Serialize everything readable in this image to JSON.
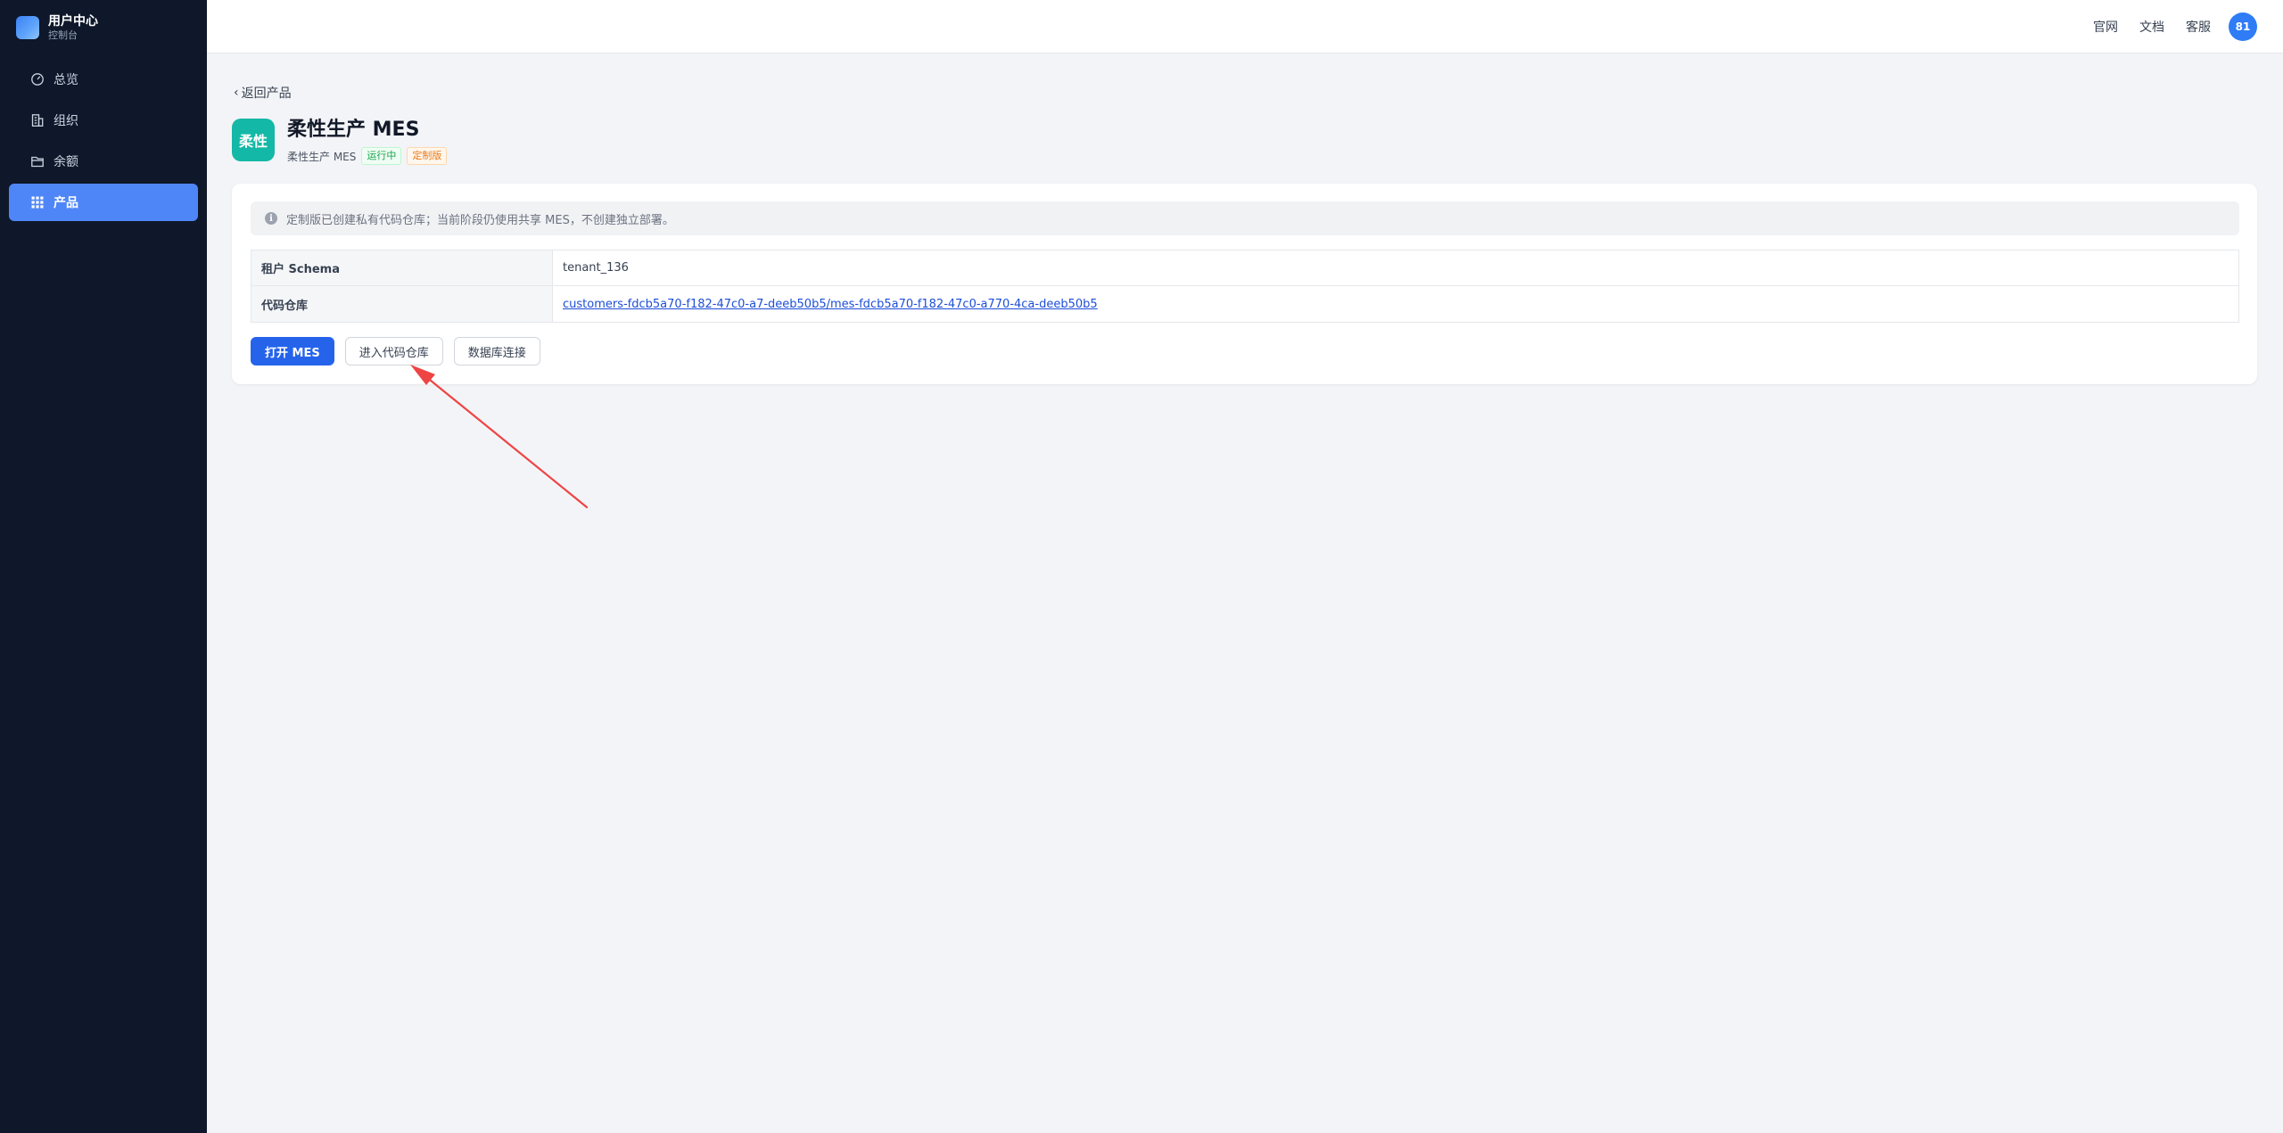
{
  "brand": {
    "title": "用户中心",
    "subtitle": "控制台"
  },
  "sidebar": {
    "items": [
      {
        "label": "总览",
        "icon": "dashboard-icon",
        "active": false
      },
      {
        "label": "组织",
        "icon": "building-icon",
        "active": false
      },
      {
        "label": "余额",
        "icon": "wallet-icon",
        "active": false
      },
      {
        "label": "产品",
        "icon": "grid-icon",
        "active": true
      }
    ]
  },
  "header": {
    "links": [
      "官网",
      "文档",
      "客服"
    ],
    "avatar_text": "81"
  },
  "main": {
    "back_label": "返回产品",
    "product": {
      "logo_text": "柔性",
      "title": "柔性生产 MES",
      "subtitle": "柔性生产 MES",
      "status_tag": "运行中",
      "edition_tag": "定制版"
    },
    "notice": "定制版已创建私有代码仓库；当前阶段仍使用共享 MES，不创建独立部署。",
    "details": [
      {
        "key": "租户 Schema",
        "value": "tenant_136"
      },
      {
        "key": "代码仓库",
        "value": "customers-fdcb5a70-f182-47c0-a7-deeb50b5/mes-fdcb5a70-f182-47c0-a770-4ca-deeb50b5"
      }
    ],
    "actions": {
      "open_mes": "打开 MES",
      "enter_repo": "进入代码仓库",
      "db_connect": "数据库连接"
    }
  },
  "colors": {
    "sidebar_bg": "#0f172a",
    "accent": "#2563eb",
    "active_nav": "#4f86f7",
    "product_logo": "#14b8a6",
    "annotation_arrow": "#ef4444"
  }
}
